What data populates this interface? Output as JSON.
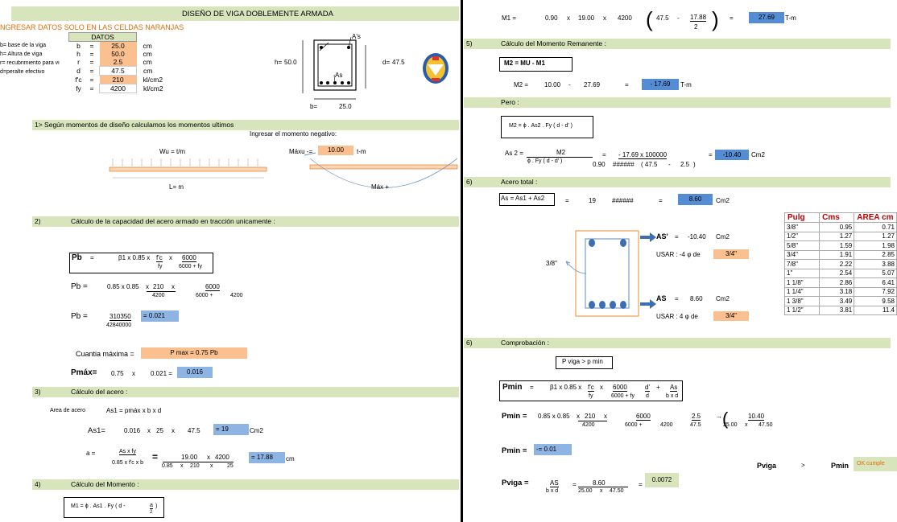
{
  "title": "DISEÑO DE VIGA DOBLEMENTE ARMADA",
  "ingresar": "NGRESAR DATOS SOLO EN LAS CELDAS NARANJAS",
  "datos_header": "DATOS",
  "desc": [
    "b= base de la viga",
    "h= Altura de viga",
    "r= recubrimiento para vi",
    "d=peralte efectivo"
  ],
  "datos": [
    {
      "sym": "b",
      "eq": "=",
      "val": "25.0",
      "unit": "cm",
      "orange": true
    },
    {
      "sym": "h",
      "eq": "=",
      "val": "50.0",
      "unit": "cm",
      "orange": true
    },
    {
      "sym": "r",
      "eq": "=",
      "val": "2.5",
      "unit": "cm",
      "orange": true
    },
    {
      "sym": "d",
      "eq": "=",
      "val": "47.5",
      "unit": "cm",
      "orange": false
    },
    {
      "sym": "f'c",
      "eq": "=",
      "val": "210",
      "unit": "kl/cm2",
      "orange": true
    },
    {
      "sym": "fy",
      "eq": "=",
      "val": "4200",
      "unit": "kl/cm2",
      "orange": false
    }
  ],
  "section": {
    "as_top": "A's",
    "as_bot": "As",
    "h_label": "h=",
    "h_val": "50.0",
    "d_label": "d=",
    "d_val": "47.5",
    "b_label": "b=",
    "b_val": "25.0"
  },
  "s1": {
    "title": "1> Según momentos de diseño calculamos los momentos ultimos",
    "ingresar": "Ingresar el momento negativo:",
    "wu": "Wu = t/m",
    "mxu": "Máxu -=",
    "mxu_val": "10.00",
    "mxu_unit": "t-m",
    "L": "L= m",
    "mx_pos": "Máx +"
  },
  "s2": {
    "num": "2)",
    "title": "Cálculo de la capacidad del acero armado en tracción unicamente :",
    "pb_label": "Pb",
    "pb_eq": "=",
    "pb_formula_a": "β1 x 0.85 x",
    "pb_formula_fc": "f'c",
    "pb_formula_x": "x",
    "pb_6000": "6000",
    "pb_fy": "fy",
    "pb_den": "6000 + fy",
    "pb2_label": "Pb =",
    "pb2_a": "0.85 x 0.85",
    "pb2_x1": "x",
    "pb2_210": "210",
    "pb2_x2": "x",
    "pb2_4200": "4200",
    "pb2_6000": "6000",
    "pb2_den": "6000 +",
    "pb2_den2": "4200",
    "pb3_label": "Pb =",
    "pb3_num": "310350",
    "pb3_den": "42840000",
    "pb3_res": "= 0.021",
    "cuantia": "Cuantia máxima =",
    "pmax_formula": "P max = 0.75 Pb",
    "pmax_label": "Pmáx=",
    "pmax_a": "0.75",
    "pmax_x": "x",
    "pmax_b": "0.021 =",
    "pmax_res": "0.016"
  },
  "s3": {
    "num": "3)",
    "title": "Cálculo del acero :",
    "area": "Area de acero",
    "as1_f": "As1 = pmáx x b x d",
    "as1_label": "As1=",
    "as1_a": "0.016",
    "as1_x1": "x",
    "as1_b": "25",
    "as1_x2": "x",
    "as1_c": "47.5",
    "as1_res": "= 19",
    "as1_unit": "Cm2",
    "a_label": "a =",
    "a_num": "As x fy",
    "a_den": "0.85 x f'c x b",
    "a_eq": "=",
    "a_n1": "19.00",
    "a_nx": "x",
    "a_n2": "4200",
    "a_d1": "0.85",
    "a_dx1": "x",
    "a_d2": "210",
    "a_dx2": "x",
    "a_d3": "25",
    "a_res": "= 17.88",
    "a_unit": "cm"
  },
  "s4": {
    "num": "4)",
    "title": "Cálculo del Momento :",
    "m1_formula": "M1 =   ϕ . As1 . Fy ( d -",
    "m1_a": "a",
    "m1_2": "2",
    ")": ")"
  },
  "r_m1": {
    "label": "M1 =",
    "a": "0.90",
    "x1": "x",
    "b": "19.00",
    "x2": "x",
    "c": "4200",
    "d": "47.5",
    "minus": "-",
    "frac_n": "17.88",
    "frac_d": "2",
    "eq": "=",
    "res": "27.69",
    "unit": "T-m"
  },
  "s5": {
    "num": "5)",
    "title": "Cálculo del Momento Remanente :",
    "m2_box": "M2 = MU - M1",
    "m2_label": "M2 =",
    "m2_a": "10.00",
    "m2_minus": "-",
    "m2_b": "27.69",
    "m2_eq": "=",
    "m2_res": "- 17.69",
    "m2_unit": "T-m",
    "pero": "Pero :",
    "pero_formula": "M2 =   ϕ . As2 . Fy ( d - d' )",
    "as2_label": "As 2 =",
    "as2_num": "M2",
    "as2_den": "ϕ . Fy ( d - d' )",
    "as2_eq": "=",
    "as2_n": "- 17.69 x 100000",
    "as2_d1": "0.90",
    "as2_d2": "######",
    "as2_d3": "( 47.5",
    "as2_d4": "-",
    "as2_d5": "2.5",
    ")": ")",
    "as2_eq2": "=",
    "as2_res": "-10.40",
    "as2_unit": "Cm2"
  },
  "s6": {
    "num": "6)",
    "title": "Acero total :",
    "as_box": "As = As1 + As2",
    "eq": "=",
    "a": "19",
    "b": "######",
    "eq2": "=",
    "res": "8.60",
    "unit": "Cm2",
    "asp_label": "AS'",
    "asp_eq": "=",
    "asp_val": "-10.40",
    "asp_unit": "Cm2",
    "usar1": "USAR : -4   φ   de",
    "usar1_val": "3/4\"",
    "as_label": "AS",
    "as_eq": "=",
    "as_val": "8.60",
    "as_unit": "Cm2",
    "usar2": "USAR : 4   φ   de",
    "usar2_val": "3/4\"",
    "stirrup": "3/8\""
  },
  "table": {
    "headers": [
      "Pulg",
      "Cms",
      "AREA cm"
    ],
    "rows": [
      [
        "3/8\"",
        "0.95",
        "0.71"
      ],
      [
        "1/2\"",
        "1.27",
        "1.27"
      ],
      [
        "5/8\"",
        "1.59",
        "1.98"
      ],
      [
        "3/4\"",
        "1.91",
        "2.85"
      ],
      [
        "7/8\"",
        "2.22",
        "3.88"
      ],
      [
        "1\"",
        "2.54",
        "5.07"
      ],
      [
        "1 1/8\"",
        "2.86",
        "6.41"
      ],
      [
        "1 1/4\"",
        "3.18",
        "7.92"
      ],
      [
        "1 3/8\"",
        "3.49",
        "9.58"
      ],
      [
        "1 1/2\"",
        "3.81",
        "11.4"
      ]
    ]
  },
  "s7": {
    "num": "6)",
    "title": "Comprobación :",
    "cond": "P viga > p min",
    "pmin_label": "Pmin",
    "pmin_eq": "=",
    "pmin_f1": "β1 x 0.85 x",
    "pmin_fc": "f'c",
    "pmin_x": "x",
    "pmin_6000": "6000",
    "pmin_dp": "d'",
    "pmin_plus": "+",
    "pmin_as": "As",
    "pmin_fy": "fy",
    "pmin_den": "6000 + fy",
    "pmin_d": "d",
    "pmin_bxd": "b x d",
    "pmin2_label": "Pmin =",
    "pmin2_a": "0.85 x 0.85",
    "pmin2_x1": "x",
    "pmin2_210": "210",
    "pmin2_x2": "x",
    "pmin2_4200": "4200",
    "pmin2_6000": "6000",
    "pmin2_den": "6000 +",
    "pmin2_den2": "4200",
    "pmin2_25": "2.5",
    "pmin2_47": "47.5",
    "pmin2_arrow": "→",
    "pmin2_n": "10.40",
    "pmin2_d1": "25.00",
    "pmin2_dx": "x",
    "pmin2_d2": "47.50",
    "pmin3_label": "Pmin =",
    "pmin3_res": "-= 0.01",
    "pviga_cmp": "Pviga",
    "gt": ">",
    "pmin_cmp": "Pmin",
    "ok": "OK cumple",
    "pviga_label": "Pviga =",
    "pviga_num": "AS",
    "pviga_den": "b x d",
    "pviga_eq": "=",
    "pviga_n": "8.60",
    "pviga_d1": "25.00",
    "pviga_dx": "x",
    "pviga_d2": "47.50",
    "pviga_eq2": "=",
    "pviga_res": "0.0072"
  }
}
